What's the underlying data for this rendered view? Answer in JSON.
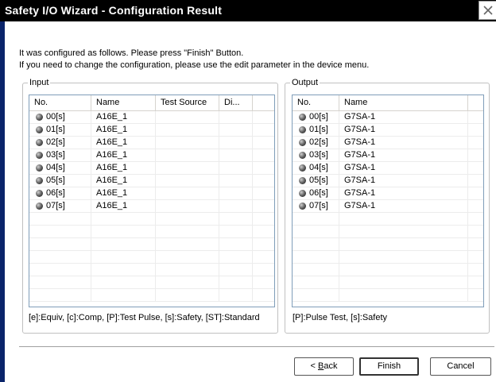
{
  "window": {
    "title": "Safety I/O Wizard - Configuration Result"
  },
  "instructions": {
    "line1": "It was configured as follows. Please press \"Finish\" Button.",
    "line2": "If you need to change the configuration, please use the edit parameter in the device menu."
  },
  "input": {
    "legend": "Input",
    "columns": [
      "No.",
      "Name",
      "Test Source",
      "Di..."
    ],
    "rows": [
      {
        "no": "00[s]",
        "name": "A16E_1"
      },
      {
        "no": "01[s]",
        "name": "A16E_1"
      },
      {
        "no": "02[s]",
        "name": "A16E_1"
      },
      {
        "no": "03[s]",
        "name": "A16E_1"
      },
      {
        "no": "04[s]",
        "name": "A16E_1"
      },
      {
        "no": "05[s]",
        "name": "A16E_1"
      },
      {
        "no": "06[s]",
        "name": "A16E_1"
      },
      {
        "no": "07[s]",
        "name": "A16E_1"
      }
    ],
    "footnote": "[e]:Equiv, [c]:Comp, [P]:Test Pulse, [s]:Safety, [ST]:Standard"
  },
  "output": {
    "legend": "Output",
    "columns": [
      "No.",
      "Name"
    ],
    "rows": [
      {
        "no": "00[s]",
        "name": "G7SA-1"
      },
      {
        "no": "01[s]",
        "name": "G7SA-1"
      },
      {
        "no": "02[s]",
        "name": "G7SA-1"
      },
      {
        "no": "03[s]",
        "name": "G7SA-1"
      },
      {
        "no": "04[s]",
        "name": "G7SA-1"
      },
      {
        "no": "05[s]",
        "name": "G7SA-1"
      },
      {
        "no": "06[s]",
        "name": "G7SA-1"
      },
      {
        "no": "07[s]",
        "name": "G7SA-1"
      }
    ],
    "footnote": "[P]:Pulse Test, [s]:Safety"
  },
  "buttons": {
    "back_prefix": "< ",
    "back_mnemonic": "B",
    "back_rest": "ack",
    "finish": "Finish",
    "cancel": "Cancel"
  },
  "icons": {
    "close": "close-icon",
    "bullet": "radio-bullet-icon"
  }
}
